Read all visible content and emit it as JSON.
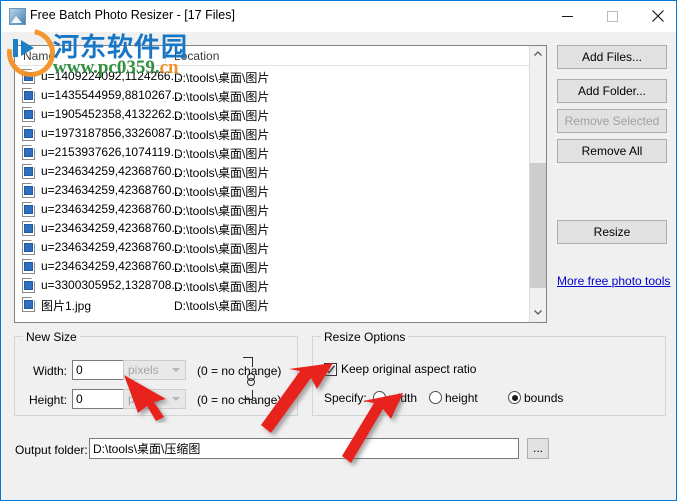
{
  "window": {
    "title": "Free Batch Photo Resizer - [17 Files]",
    "app_icon": "photo-app-icon",
    "accent_color": "#0078d7",
    "background_color": "#f0f0f0",
    "controls": {
      "minimize": "minimize-icon",
      "maximize": "maximize-icon",
      "close": "close-icon"
    }
  },
  "watermark": {
    "site_name": "河东软件园",
    "url_main": "www.pc0359.",
    "url_tld": "cn",
    "brand_blue": "#1876c4",
    "brand_orange": "#f39325",
    "brand_green": "#2f8f3f"
  },
  "file_list": {
    "columns": [
      "Name",
      "Location"
    ],
    "rows": [
      {
        "name": "u=1409224092,1124266...",
        "location": "D:\\tools\\桌面\\图片"
      },
      {
        "name": "u=1435544959,8810267...",
        "location": "D:\\tools\\桌面\\图片"
      },
      {
        "name": "u=1905452358,4132262...",
        "location": "D:\\tools\\桌面\\图片"
      },
      {
        "name": "u=1973187856,3326087...",
        "location": "D:\\tools\\桌面\\图片"
      },
      {
        "name": "u=2153937626,1074119...",
        "location": "D:\\tools\\桌面\\图片"
      },
      {
        "name": "u=234634259,42368760...",
        "location": "D:\\tools\\桌面\\图片"
      },
      {
        "name": "u=234634259,42368760...",
        "location": "D:\\tools\\桌面\\图片"
      },
      {
        "name": "u=234634259,42368760...",
        "location": "D:\\tools\\桌面\\图片"
      },
      {
        "name": "u=234634259,42368760...",
        "location": "D:\\tools\\桌面\\图片"
      },
      {
        "name": "u=234634259,42368760...",
        "location": "D:\\tools\\桌面\\图片"
      },
      {
        "name": "u=234634259,42368760...",
        "location": "D:\\tools\\桌面\\图片"
      },
      {
        "name": "u=3300305952,1328708...",
        "location": "D:\\tools\\桌面\\图片"
      },
      {
        "name": "图片1.jpg",
        "location": "D:\\tools\\桌面\\图片"
      }
    ],
    "scrollbar": {
      "up_arrow": "scroll-up-icon",
      "down_arrow": "scroll-down-icon"
    }
  },
  "actions": {
    "add_files": "Add Files...",
    "add_folder": "Add Folder...",
    "remove_selected": "Remove Selected",
    "remove_selected_enabled": false,
    "remove_all": "Remove All",
    "resize": "Resize",
    "more_tools_link": "More free photo tools"
  },
  "new_size": {
    "group_title": "New Size",
    "width_label": "Width:",
    "width_value": "0",
    "width_unit": "pixels",
    "width_hint": "(0 = no change)",
    "height_label": "Height:",
    "height_value": "0",
    "height_unit": "pixels",
    "height_hint": "(0 = no change)",
    "link_icon": "chain-link-icon",
    "units_enabled": false
  },
  "resize_options": {
    "group_title": "Resize Options",
    "keep_aspect_label": "Keep original aspect ratio",
    "keep_aspect_checked": true,
    "specify_label": "Specify:",
    "radios": [
      {
        "label": "width",
        "selected": false
      },
      {
        "label": "height",
        "selected": false
      },
      {
        "label": "bounds",
        "selected": true
      }
    ]
  },
  "output": {
    "label": "Output folder:",
    "value": "D:\\tools\\桌面\\压缩图",
    "browse_label": "...",
    "browse_icon": "ellipsis-icon"
  },
  "annotations": {
    "arrow_color": "#e8241d",
    "arrows": [
      {
        "id": "arrow-to-units-dropdown",
        "points_at": "height-unit-select"
      },
      {
        "id": "arrow-to-keep-aspect",
        "points_at": "keep-aspect-checkbox"
      },
      {
        "id": "arrow-to-specify-radios",
        "points_at": "specify-radio-group"
      }
    ]
  }
}
